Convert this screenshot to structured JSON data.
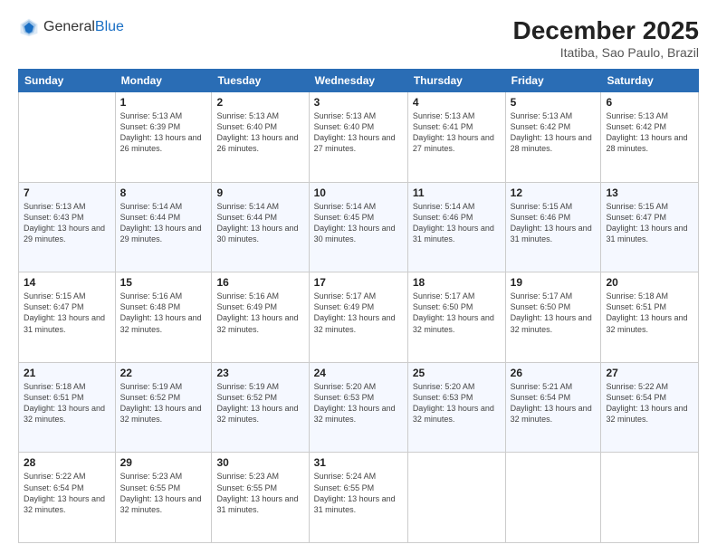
{
  "header": {
    "logo_general": "General",
    "logo_blue": "Blue",
    "month_title": "December 2025",
    "location": "Itatiba, Sao Paulo, Brazil"
  },
  "days_of_week": [
    "Sunday",
    "Monday",
    "Tuesday",
    "Wednesday",
    "Thursday",
    "Friday",
    "Saturday"
  ],
  "weeks": [
    [
      {
        "day": "",
        "sunrise": "",
        "sunset": "",
        "daylight": ""
      },
      {
        "day": "1",
        "sunrise": "Sunrise: 5:13 AM",
        "sunset": "Sunset: 6:39 PM",
        "daylight": "Daylight: 13 hours and 26 minutes."
      },
      {
        "day": "2",
        "sunrise": "Sunrise: 5:13 AM",
        "sunset": "Sunset: 6:40 PM",
        "daylight": "Daylight: 13 hours and 26 minutes."
      },
      {
        "day": "3",
        "sunrise": "Sunrise: 5:13 AM",
        "sunset": "Sunset: 6:40 PM",
        "daylight": "Daylight: 13 hours and 27 minutes."
      },
      {
        "day": "4",
        "sunrise": "Sunrise: 5:13 AM",
        "sunset": "Sunset: 6:41 PM",
        "daylight": "Daylight: 13 hours and 27 minutes."
      },
      {
        "day": "5",
        "sunrise": "Sunrise: 5:13 AM",
        "sunset": "Sunset: 6:42 PM",
        "daylight": "Daylight: 13 hours and 28 minutes."
      },
      {
        "day": "6",
        "sunrise": "Sunrise: 5:13 AM",
        "sunset": "Sunset: 6:42 PM",
        "daylight": "Daylight: 13 hours and 28 minutes."
      }
    ],
    [
      {
        "day": "7",
        "sunrise": "Sunrise: 5:13 AM",
        "sunset": "Sunset: 6:43 PM",
        "daylight": "Daylight: 13 hours and 29 minutes."
      },
      {
        "day": "8",
        "sunrise": "Sunrise: 5:14 AM",
        "sunset": "Sunset: 6:44 PM",
        "daylight": "Daylight: 13 hours and 29 minutes."
      },
      {
        "day": "9",
        "sunrise": "Sunrise: 5:14 AM",
        "sunset": "Sunset: 6:44 PM",
        "daylight": "Daylight: 13 hours and 30 minutes."
      },
      {
        "day": "10",
        "sunrise": "Sunrise: 5:14 AM",
        "sunset": "Sunset: 6:45 PM",
        "daylight": "Daylight: 13 hours and 30 minutes."
      },
      {
        "day": "11",
        "sunrise": "Sunrise: 5:14 AM",
        "sunset": "Sunset: 6:46 PM",
        "daylight": "Daylight: 13 hours and 31 minutes."
      },
      {
        "day": "12",
        "sunrise": "Sunrise: 5:15 AM",
        "sunset": "Sunset: 6:46 PM",
        "daylight": "Daylight: 13 hours and 31 minutes."
      },
      {
        "day": "13",
        "sunrise": "Sunrise: 5:15 AM",
        "sunset": "Sunset: 6:47 PM",
        "daylight": "Daylight: 13 hours and 31 minutes."
      }
    ],
    [
      {
        "day": "14",
        "sunrise": "Sunrise: 5:15 AM",
        "sunset": "Sunset: 6:47 PM",
        "daylight": "Daylight: 13 hours and 31 minutes."
      },
      {
        "day": "15",
        "sunrise": "Sunrise: 5:16 AM",
        "sunset": "Sunset: 6:48 PM",
        "daylight": "Daylight: 13 hours and 32 minutes."
      },
      {
        "day": "16",
        "sunrise": "Sunrise: 5:16 AM",
        "sunset": "Sunset: 6:49 PM",
        "daylight": "Daylight: 13 hours and 32 minutes."
      },
      {
        "day": "17",
        "sunrise": "Sunrise: 5:17 AM",
        "sunset": "Sunset: 6:49 PM",
        "daylight": "Daylight: 13 hours and 32 minutes."
      },
      {
        "day": "18",
        "sunrise": "Sunrise: 5:17 AM",
        "sunset": "Sunset: 6:50 PM",
        "daylight": "Daylight: 13 hours and 32 minutes."
      },
      {
        "day": "19",
        "sunrise": "Sunrise: 5:17 AM",
        "sunset": "Sunset: 6:50 PM",
        "daylight": "Daylight: 13 hours and 32 minutes."
      },
      {
        "day": "20",
        "sunrise": "Sunrise: 5:18 AM",
        "sunset": "Sunset: 6:51 PM",
        "daylight": "Daylight: 13 hours and 32 minutes."
      }
    ],
    [
      {
        "day": "21",
        "sunrise": "Sunrise: 5:18 AM",
        "sunset": "Sunset: 6:51 PM",
        "daylight": "Daylight: 13 hours and 32 minutes."
      },
      {
        "day": "22",
        "sunrise": "Sunrise: 5:19 AM",
        "sunset": "Sunset: 6:52 PM",
        "daylight": "Daylight: 13 hours and 32 minutes."
      },
      {
        "day": "23",
        "sunrise": "Sunrise: 5:19 AM",
        "sunset": "Sunset: 6:52 PM",
        "daylight": "Daylight: 13 hours and 32 minutes."
      },
      {
        "day": "24",
        "sunrise": "Sunrise: 5:20 AM",
        "sunset": "Sunset: 6:53 PM",
        "daylight": "Daylight: 13 hours and 32 minutes."
      },
      {
        "day": "25",
        "sunrise": "Sunrise: 5:20 AM",
        "sunset": "Sunset: 6:53 PM",
        "daylight": "Daylight: 13 hours and 32 minutes."
      },
      {
        "day": "26",
        "sunrise": "Sunrise: 5:21 AM",
        "sunset": "Sunset: 6:54 PM",
        "daylight": "Daylight: 13 hours and 32 minutes."
      },
      {
        "day": "27",
        "sunrise": "Sunrise: 5:22 AM",
        "sunset": "Sunset: 6:54 PM",
        "daylight": "Daylight: 13 hours and 32 minutes."
      }
    ],
    [
      {
        "day": "28",
        "sunrise": "Sunrise: 5:22 AM",
        "sunset": "Sunset: 6:54 PM",
        "daylight": "Daylight: 13 hours and 32 minutes."
      },
      {
        "day": "29",
        "sunrise": "Sunrise: 5:23 AM",
        "sunset": "Sunset: 6:55 PM",
        "daylight": "Daylight: 13 hours and 32 minutes."
      },
      {
        "day": "30",
        "sunrise": "Sunrise: 5:23 AM",
        "sunset": "Sunset: 6:55 PM",
        "daylight": "Daylight: 13 hours and 31 minutes."
      },
      {
        "day": "31",
        "sunrise": "Sunrise: 5:24 AM",
        "sunset": "Sunset: 6:55 PM",
        "daylight": "Daylight: 13 hours and 31 minutes."
      },
      {
        "day": "",
        "sunrise": "",
        "sunset": "",
        "daylight": ""
      },
      {
        "day": "",
        "sunrise": "",
        "sunset": "",
        "daylight": ""
      },
      {
        "day": "",
        "sunrise": "",
        "sunset": "",
        "daylight": ""
      }
    ]
  ]
}
